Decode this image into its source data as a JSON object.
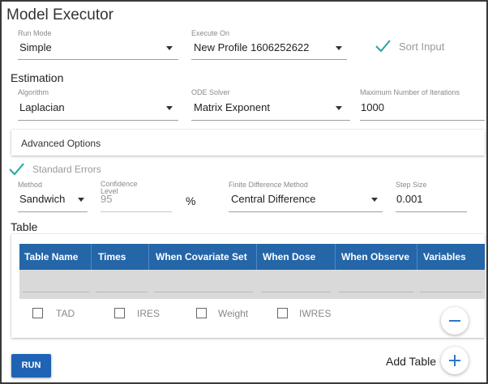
{
  "app": {
    "title": "Model Executor"
  },
  "run_mode": {
    "label": "Run Mode",
    "value": "Simple"
  },
  "execute_on": {
    "label": "Execute On",
    "value": "New Profile 1606252622"
  },
  "sort_input": {
    "label": "Sort Input",
    "checked": true
  },
  "estimation": {
    "heading": "Estimation",
    "algorithm": {
      "label": "Algorithm",
      "value": "Laplacian"
    },
    "ode_solver": {
      "label": "ODE Solver",
      "value": "Matrix Exponent"
    },
    "max_iterations": {
      "label": "Maximum Number of Iterations",
      "value": "1000"
    }
  },
  "advanced": {
    "label": "Advanced Options"
  },
  "standard_errors": {
    "label": "Standard Errors",
    "checked": true,
    "method": {
      "label": "Method",
      "value": "Sandwich"
    },
    "confidence": {
      "label": "Confidence Level",
      "value": "95",
      "unit": "%"
    },
    "finite_diff": {
      "label": "Finite Difference Method",
      "value": "Central Difference"
    },
    "step_size": {
      "label": "Step Size",
      "value": "0.001"
    }
  },
  "table": {
    "heading": "Table",
    "columns": [
      "Table Name",
      "Times",
      "When Covariate Set",
      "When Dose",
      "When Observe",
      "Variables"
    ],
    "options": [
      {
        "label": "TAD",
        "checked": false
      },
      {
        "label": "IRES",
        "checked": false
      },
      {
        "label": "Weight",
        "checked": false
      },
      {
        "label": "IWRES",
        "checked": false
      }
    ]
  },
  "actions": {
    "run": "RUN",
    "add_table": "Add Table"
  },
  "colors": {
    "accent": "#1f63b4",
    "header": "#2466a8",
    "check": "#26a69a"
  }
}
